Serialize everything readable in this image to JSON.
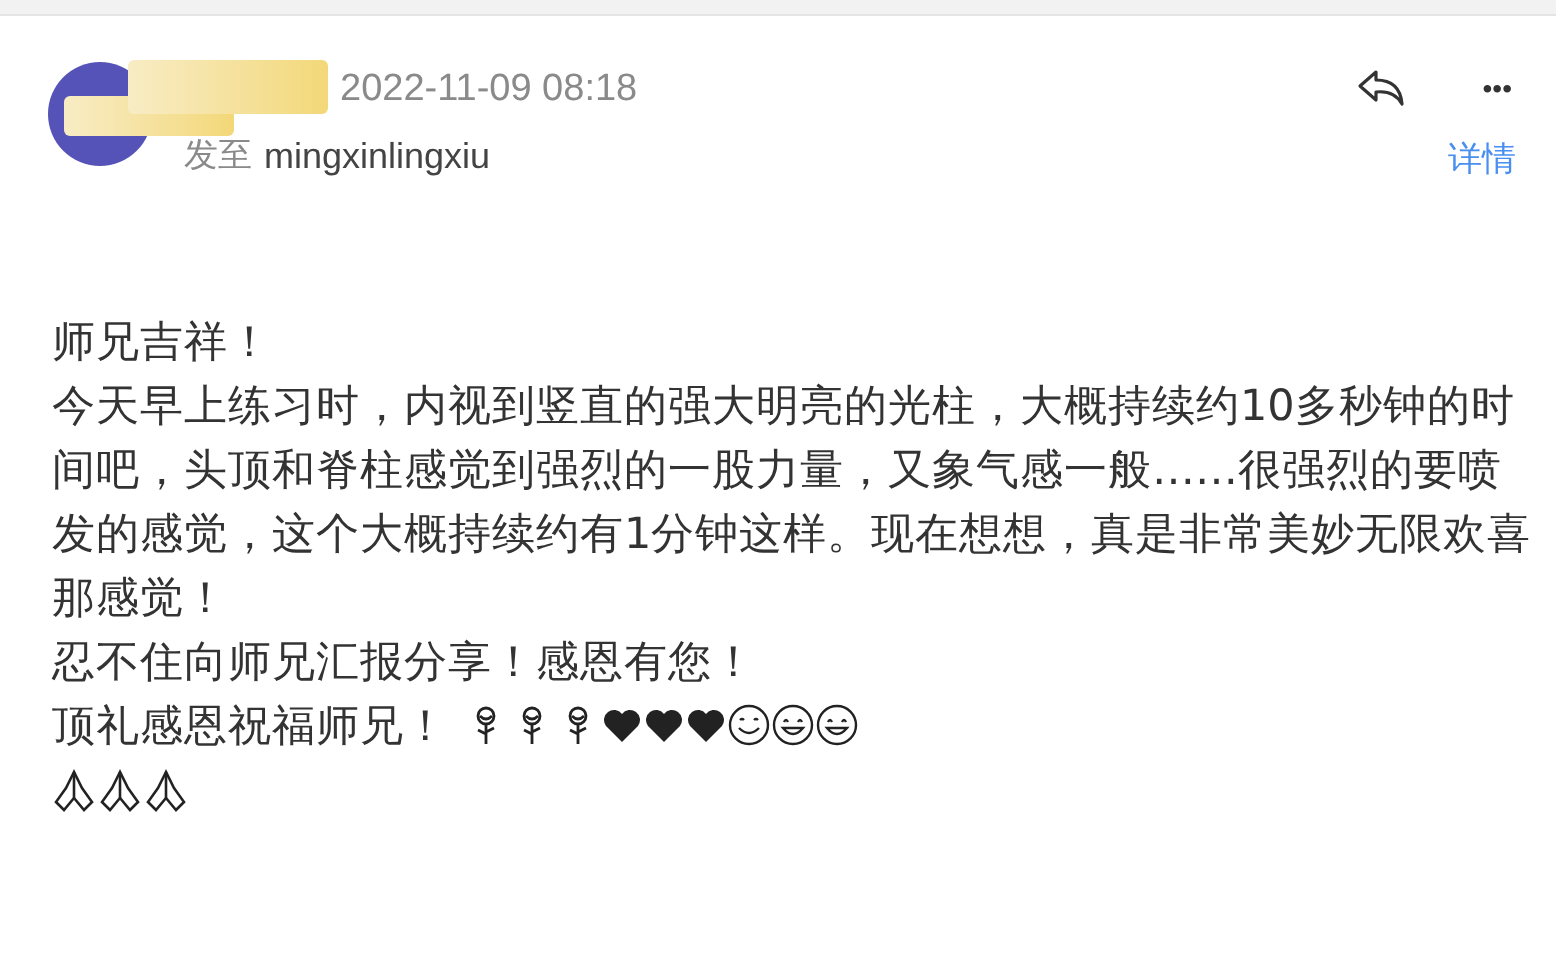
{
  "header": {
    "date": "2022-11-09 08:18",
    "recipient_prefix": "发至",
    "recipient": "mingxinlingxiu",
    "details_link": "详情",
    "more_label": "•••"
  },
  "body": {
    "paragraphs": [
      "师兄吉祥！",
      "今天早上练习时，内视到竖直的强大明亮的光柱，大概持续约10多秒钟的时间吧，头顶和脊柱感觉到强烈的一股力量，又象气感一般……很强烈的要喷发的感觉，这个大概持续约有1分钟这样。现在想想，真是非常美妙无限欢喜那感觉！",
      "忍不住向师兄汇报分享！感恩有您！",
      "顶礼感恩祝福师兄！"
    ],
    "emojis": [
      {
        "kind": "rose"
      },
      {
        "kind": "rose"
      },
      {
        "kind": "rose"
      },
      {
        "kind": "heart"
      },
      {
        "kind": "heart"
      },
      {
        "kind": "heart"
      },
      {
        "kind": "smile"
      },
      {
        "kind": "grin"
      },
      {
        "kind": "grin"
      }
    ],
    "last_line_emojis": [
      {
        "kind": "pray"
      },
      {
        "kind": "pray"
      },
      {
        "kind": "pray"
      }
    ]
  }
}
